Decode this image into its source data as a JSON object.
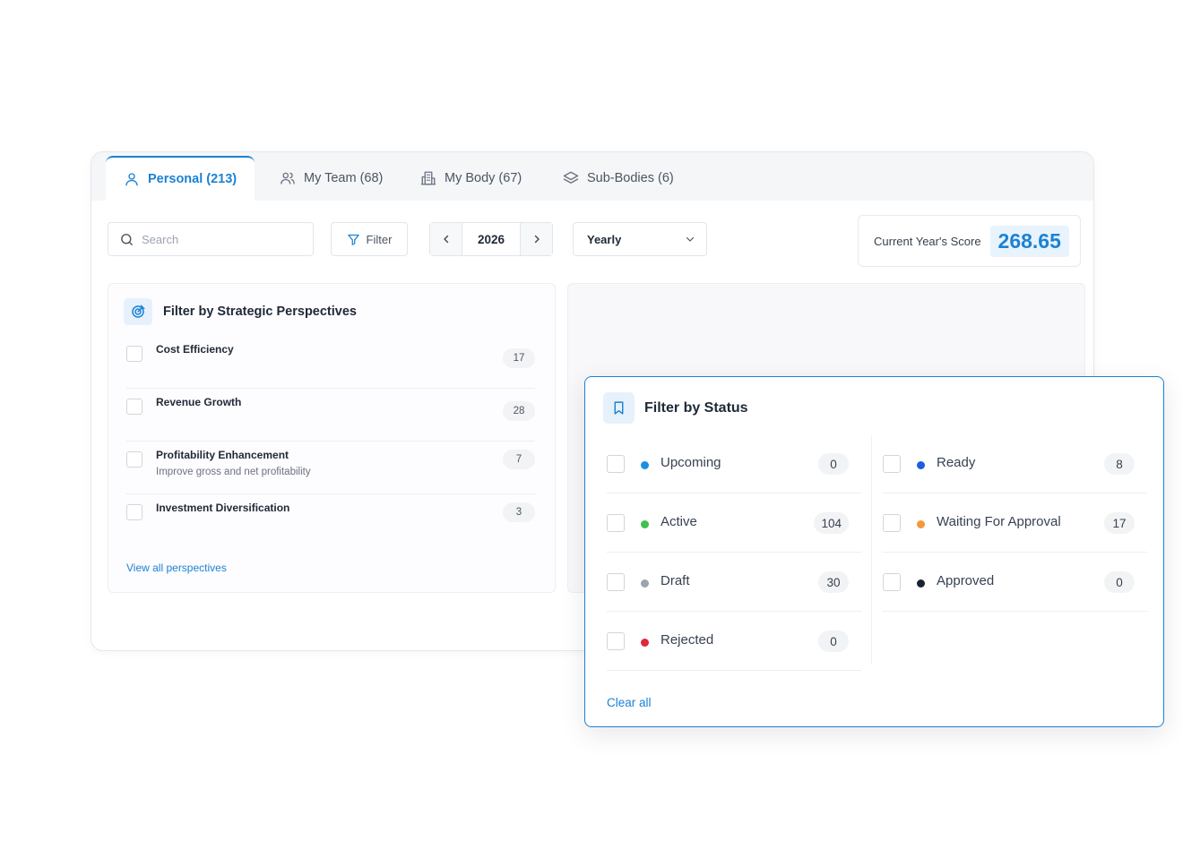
{
  "tabs": [
    {
      "label": "Personal (213)",
      "icon": "user-icon",
      "active": true
    },
    {
      "label": "My Team (68)",
      "icon": "users-icon",
      "active": false
    },
    {
      "label": "My Body (67)",
      "icon": "building-icon",
      "active": false
    },
    {
      "label": "Sub-Bodies (6)",
      "icon": "layers-icon",
      "active": false
    }
  ],
  "toolbar": {
    "search_placeholder": "Search",
    "filter_label": "Filter",
    "year": "2026",
    "period": "Yearly"
  },
  "score": {
    "label": "Current Year's Score",
    "value": "268.65"
  },
  "perspectives": {
    "title": "Filter by Strategic Perspectives",
    "items": [
      {
        "name": "Cost Efficiency",
        "description": "",
        "count": "17"
      },
      {
        "name": "Revenue Growth",
        "description": "",
        "count": "28"
      },
      {
        "name": "Profitability Enhancement",
        "description": "Improve gross and net profitability",
        "count": "7"
      },
      {
        "name": "Investment Diversification",
        "description": "",
        "count": "3"
      }
    ],
    "view_all": "View all perspectives"
  },
  "status_filter": {
    "title": "Filter by Status",
    "left": [
      {
        "name": "Upcoming",
        "count": "0",
        "color": "#1a8fe3"
      },
      {
        "name": "Active",
        "count": "104",
        "color": "#3cc14a"
      },
      {
        "name": "Draft",
        "count": "30",
        "color": "#9ca3af"
      },
      {
        "name": "Rejected",
        "count": "0",
        "color": "#e0263a"
      }
    ],
    "right": [
      {
        "name": "Ready",
        "count": "8",
        "color": "#1c5fe0"
      },
      {
        "name": "Waiting For Approval",
        "count": "17",
        "color": "#f5963a"
      },
      {
        "name": "Approved",
        "count": "0",
        "color": "#1a2233"
      }
    ],
    "clear_all": "Clear all"
  },
  "accent_color": "#1b82d4"
}
